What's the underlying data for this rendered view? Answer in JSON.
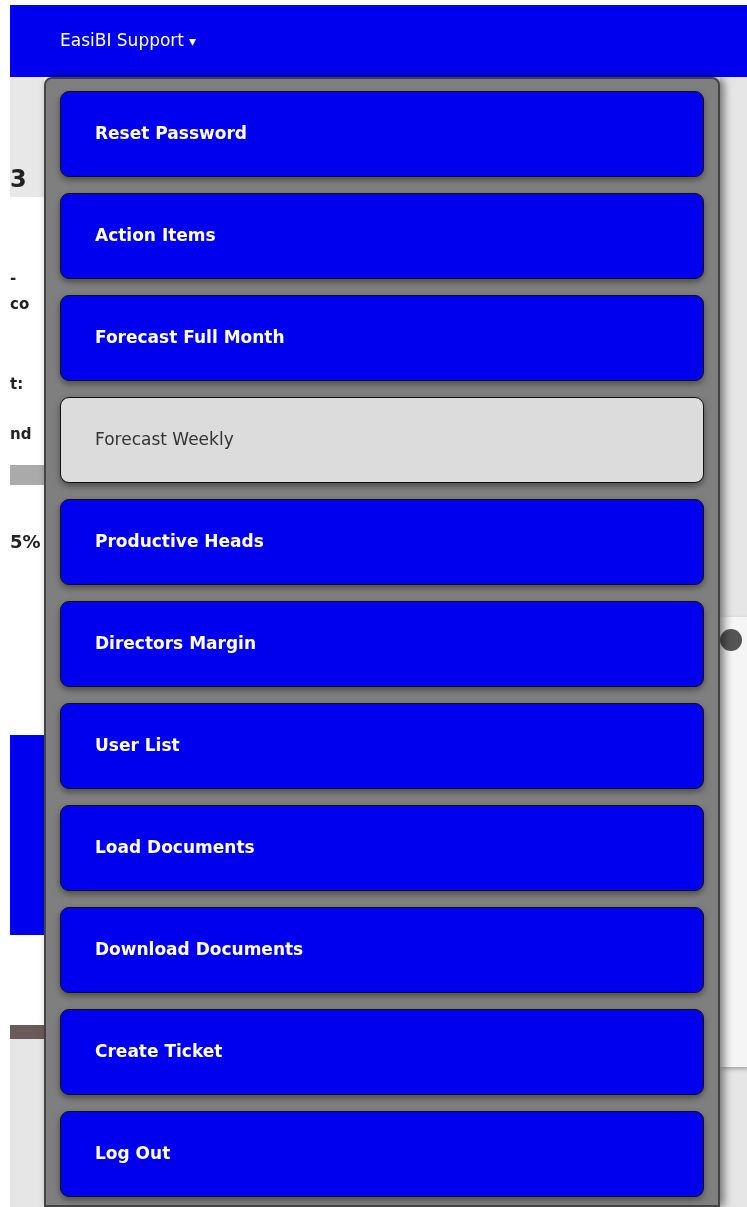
{
  "navbar": {
    "title": "EasiBI Support",
    "caret": "▾"
  },
  "background_fragments": [
    {
      "kind": "heading",
      "text": "3"
    },
    {
      "kind": "label",
      "text": "-"
    },
    {
      "kind": "label",
      "text": "co"
    },
    {
      "kind": "label",
      "text": "t:"
    },
    {
      "kind": "label",
      "text": "nd"
    },
    {
      "kind": "big",
      "text": "5%"
    }
  ],
  "menu": [
    {
      "label": "Reset Password",
      "selected": false
    },
    {
      "label": "Action Items",
      "selected": false
    },
    {
      "label": "Forecast Full Month",
      "selected": false
    },
    {
      "label": "Forecast Weekly",
      "selected": true
    },
    {
      "label": "Productive Heads",
      "selected": false
    },
    {
      "label": "Directors Margin",
      "selected": false
    },
    {
      "label": "User List",
      "selected": false
    },
    {
      "label": "Load Documents",
      "selected": false
    },
    {
      "label": "Download Documents",
      "selected": false
    },
    {
      "label": "Create Ticket",
      "selected": false
    },
    {
      "label": "Log Out",
      "selected": false
    }
  ]
}
